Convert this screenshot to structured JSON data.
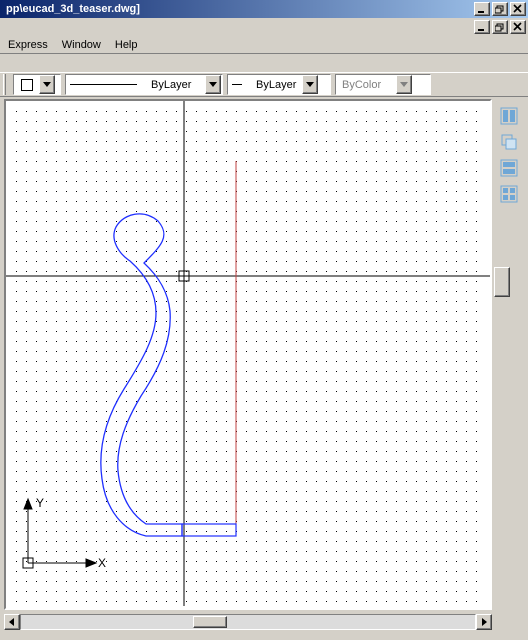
{
  "window": {
    "title_path": "pp\\eucad_3d_teaser.dwg]"
  },
  "menu": {
    "express": "Express",
    "window": "Window",
    "help": "Help"
  },
  "toolbar": {
    "color_swatch": "#ffffff",
    "linetype_label": "ByLayer",
    "lineweight_label": "ByLayer",
    "plotstyle_label": "ByColor"
  },
  "axes": {
    "x": "X",
    "y": "Y"
  },
  "caption_buttons": {
    "top": [
      "min",
      "restore",
      "close"
    ],
    "mdi": [
      "min",
      "restore",
      "close"
    ]
  },
  "right_tools": [
    "tile-vert-icon",
    "tile-cascade-icon",
    "tile-horiz-icon",
    "tile-quad-icon"
  ]
}
